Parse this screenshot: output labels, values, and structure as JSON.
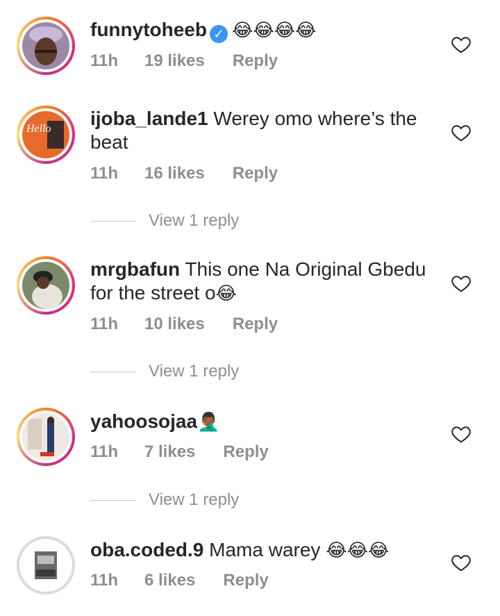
{
  "comments": [
    {
      "username": "funnytoheeb",
      "text": "",
      "emojis": "😂😂😂😂",
      "verified": true,
      "time": "11h",
      "likes": "19 likes",
      "reply": "Reply",
      "icon": "heart-outline-icon"
    },
    {
      "username": "ijoba_lande1",
      "text": "Werey omo where’s the beat",
      "emojis": "",
      "verified": false,
      "time": "11h",
      "likes": "16 likes",
      "reply": "Reply",
      "view_replies": "View 1 reply",
      "icon": "heart-outline-icon"
    },
    {
      "username": "mrgbafun",
      "text": "This one Na Original Gbedu for the street o",
      "emojis": "😂",
      "verified": false,
      "time": "11h",
      "likes": "10 likes",
      "reply": "Reply",
      "view_replies": "View 1 reply",
      "icon": "heart-outline-icon"
    },
    {
      "username": "yahoosojaa",
      "text": "",
      "emojis": "🤦🏾‍♂️",
      "verified": false,
      "time": "11h",
      "likes": "7 likes",
      "reply": "Reply",
      "view_replies": "View 1 reply",
      "icon": "heart-outline-icon"
    },
    {
      "username": "oba.coded.9",
      "text": "Mama warey",
      "emojis": "😂😂😂",
      "verified": false,
      "time": "11h",
      "likes": "6 likes",
      "reply": "Reply",
      "icon": "heart-outline-icon"
    }
  ],
  "colors": {
    "text": "#262626",
    "muted": "#8e8e8e",
    "verified": "#3897f0"
  }
}
